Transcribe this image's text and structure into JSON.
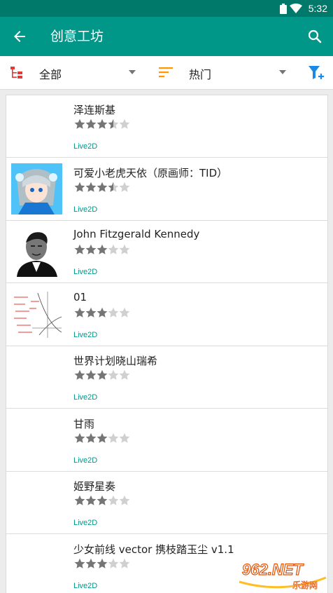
{
  "status": {
    "time": "5:32"
  },
  "appbar": {
    "title": "创意工坊"
  },
  "filters": {
    "category": "全部",
    "sort": "热门"
  },
  "items": [
    {
      "name": "泽连斯基",
      "rating": 3.5,
      "tag": "Live2D",
      "thumb": "none"
    },
    {
      "name": "可爱小老虎天依（原画师：TID）",
      "rating": 3.5,
      "tag": "Live2D",
      "thumb": "anime"
    },
    {
      "name": "John Fitzgerald Kennedy",
      "rating": 3,
      "tag": "Live2D",
      "thumb": "portrait"
    },
    {
      "name": "01",
      "rating": 3,
      "tag": "Live2D",
      "thumb": "graph"
    },
    {
      "name": "世界计划晓山瑞希",
      "rating": 3,
      "tag": "Live2D",
      "thumb": "none"
    },
    {
      "name": "甘雨",
      "rating": 3,
      "tag": "Live2D",
      "thumb": "none"
    },
    {
      "name": "姬野星奏",
      "rating": 3,
      "tag": "Live2D",
      "thumb": "none"
    },
    {
      "name": "少女前线 vector 携枝踏玉尘 v1.1",
      "rating": 3,
      "tag": "Live2D",
      "thumb": "none"
    }
  ],
  "watermark": {
    "main": "962.NET",
    "sub": "乐游网"
  },
  "colors": {
    "primary": "#009688",
    "statusbar": "#00796b",
    "category_icon": "#e53935",
    "sort_icon": "#ff9800",
    "filter_icon": "#1e88e5",
    "star_on": "#757575",
    "star_off": "#d0d0d0"
  }
}
